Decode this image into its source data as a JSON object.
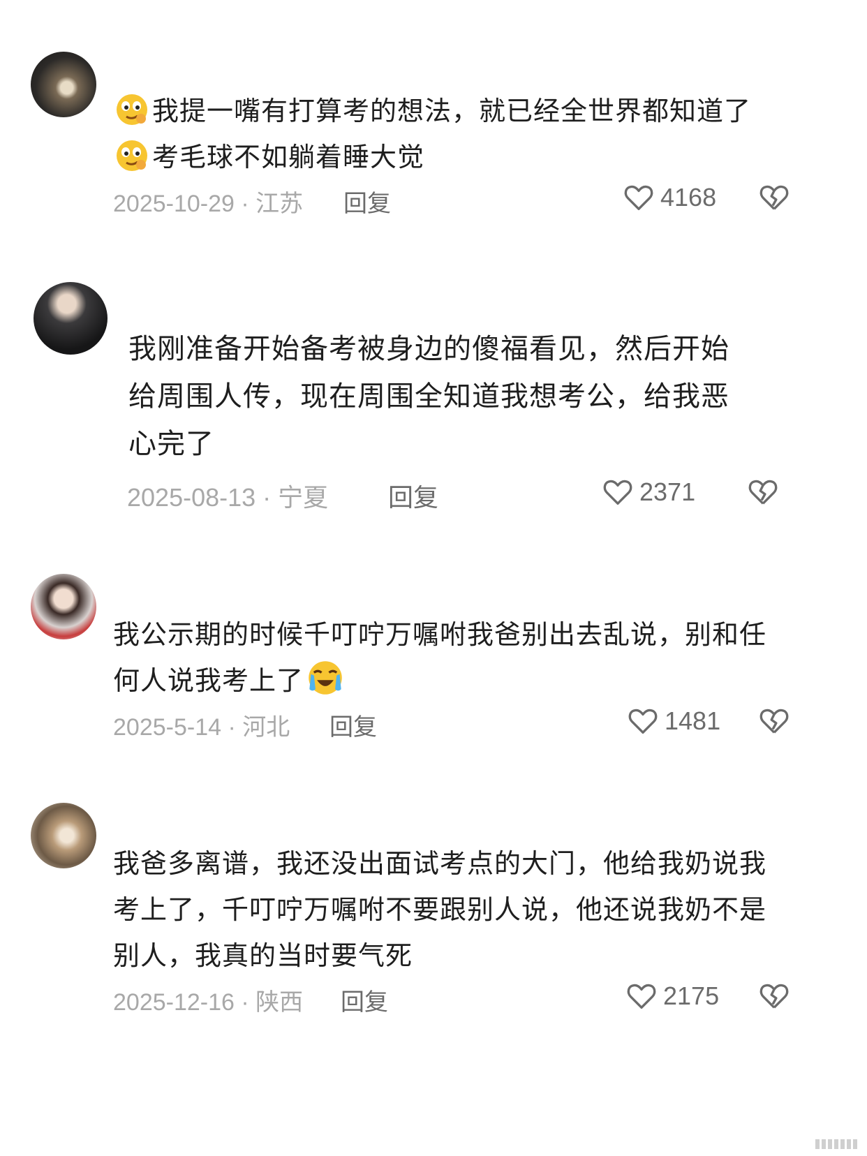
{
  "comments": [
    {
      "lines": [
        "我提一嘴有打算考的想法，就已经全世界都知道了",
        "考毛球不如躺着睡大觉"
      ],
      "line_emojis": [
        "smirk-face",
        "smirk-face"
      ],
      "date": "2025-10-29",
      "location": "江苏",
      "reply_label": "回复",
      "likes": "4168"
    },
    {
      "lines": [
        "我刚准备开始备考被身边的傻福看见，然后开始",
        "给周围人传，现在周围全知道我想考公，给我恶",
        "心完了"
      ],
      "date": "2025-08-13",
      "location": "宁夏",
      "reply_label": "回复",
      "likes": "2371"
    },
    {
      "lines": [
        "我公示期的时候千叮咛万嘱咐我爸别出去乱说，别和任",
        "何人说我考上了"
      ],
      "trailing_emoji": "crying-face",
      "date": "2025-5-14",
      "location": "河北",
      "reply_label": "回复",
      "likes": "1481"
    },
    {
      "lines": [
        "我爸多离谱，我还没出面试考点的大门，他给我奶说我",
        "考上了，千叮咛万嘱咐不要跟别人说，他还说我奶不是",
        "别人，我真的当时要气死"
      ],
      "date": "2025-12-16",
      "location": "陕西",
      "reply_label": "回复",
      "likes": "2175"
    }
  ],
  "colors": {
    "meta": "#a8a8a8",
    "icon": "#6b6b6b",
    "emoji": "#f7c531"
  }
}
